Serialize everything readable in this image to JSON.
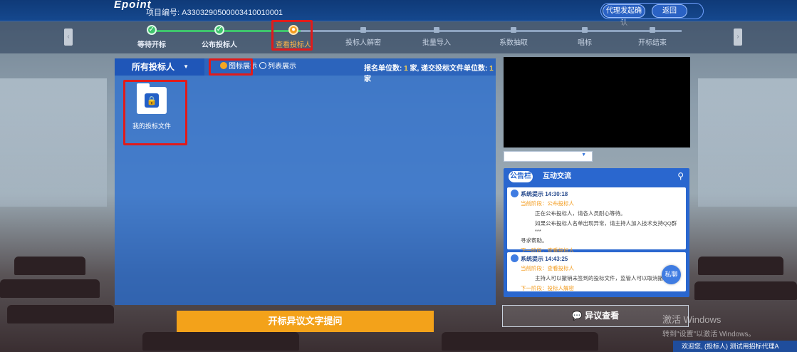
{
  "header": {
    "logo": "Epoint",
    "project_label": "项目编号:",
    "project_no": "A3303290500003410010001",
    "agent_confirm_button": "代理发起确认",
    "back_button": "返回"
  },
  "progress": {
    "steps": [
      {
        "label": "等待开标",
        "state": "done"
      },
      {
        "label": "公布投标人",
        "state": "done"
      },
      {
        "label": "查看投标人",
        "state": "current"
      },
      {
        "label": "投标人解密",
        "state": "todo"
      },
      {
        "label": "批量导入",
        "state": "todo"
      },
      {
        "label": "系数抽取",
        "state": "todo"
      },
      {
        "label": "唱标",
        "state": "todo"
      },
      {
        "label": "开标结束",
        "state": "todo"
      }
    ]
  },
  "left_panel": {
    "selector": "所有投标人",
    "view_icon": "图标展示",
    "view_list": "列表展示",
    "counts_prefix": "报名单位数:",
    "registered_count": "1",
    "counts_mid": "家, 递交投标文件单位数:",
    "submitted_count": "1",
    "counts_suffix": "家",
    "file_label": "我的投标文件"
  },
  "objection_button": "开标异议文字提问",
  "view_objection_button": "异议查看",
  "chat": {
    "tab_notice": "公告栏",
    "tab_interact": "互动交流",
    "private_button": "私聊",
    "messages": [
      {
        "head": "系统提示 14:30:18",
        "stage": "当前阶段：公布投标人",
        "line1": "正在公布投标人，请各人员耐心等待。",
        "line2": "如果公布投标人名单出现异常，请主持人加入技术支持QQ群***",
        "line3": "寻求帮助。",
        "next": "下一阶段：查看投标人"
      },
      {
        "head": "系统提示 14:43:25",
        "stage": "当前阶段：查看投标人",
        "line1": "主持人可以撤销未签到的投标文件，监管人可以取消撤销",
        "next": "下一阶段：投标人解密"
      }
    ]
  },
  "watermark": {
    "line1": "激活 Windows",
    "line2": "转到\"设置\"以激活 Windows。"
  },
  "status": "欢迎您, (投标人) 测试用招标代理A"
}
